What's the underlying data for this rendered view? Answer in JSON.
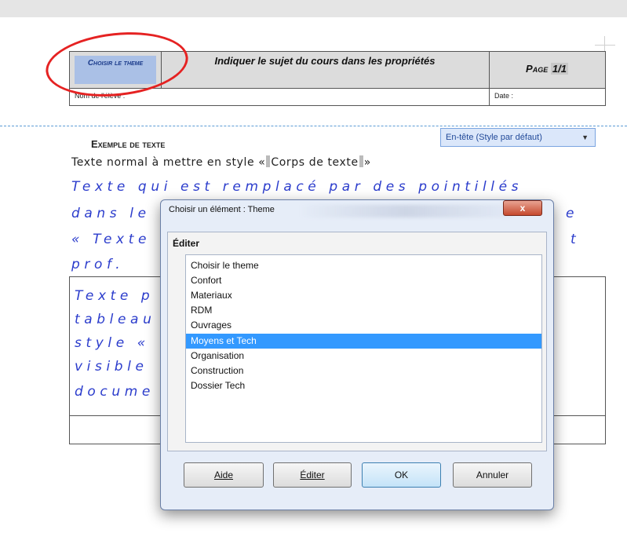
{
  "document": {
    "header_table": {
      "theme_field": "Choisir le theme",
      "title": "Indiquer le sujet du cours dans les propriétés",
      "page_label": "Page",
      "page_number": "1/1",
      "nom_label": "Nom de l'élève :",
      "date_label": "Date :"
    },
    "header_style_tag": "En-tête (Style par défaut)",
    "example_title": "Exemple de texte",
    "normal_text_pre": "Texte normal à mettre en style «",
    "normal_text_style": "Corps de texte",
    "normal_text_post": "»",
    "blue_lines": [
      "Texte qui est remplacé par des pointillés",
      "dans le",
      "« Texte",
      "prof."
    ],
    "blue_lines_right": [
      "e",
      "t"
    ],
    "table_lines": [
      "Texte p",
      "tableau",
      "style «",
      "visible",
      "docume"
    ]
  },
  "dialog": {
    "title": "Choisir un élément : Theme",
    "close_label": "x",
    "frame_label": "Éditer",
    "items": [
      "Choisir le theme",
      "Confort",
      "Materiaux",
      "RDM",
      "Ouvrages",
      "Moyens et Tech",
      "Organisation",
      "Construction",
      "Dossier Tech"
    ],
    "selected_index": 5,
    "buttons": {
      "aide": "Aide",
      "editer": "Éditer",
      "ok": "OK",
      "annuler": "Annuler"
    }
  },
  "colors": {
    "annotation_ellipse": "#e52222",
    "selection": "#3399ff",
    "placeholder_text": "#2b3ccc"
  }
}
